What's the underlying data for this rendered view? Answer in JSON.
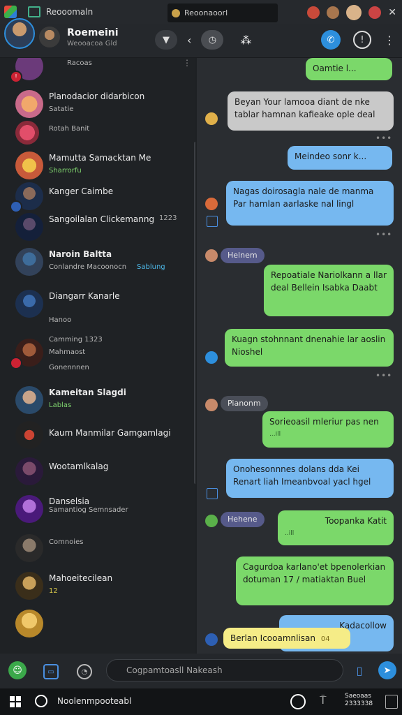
{
  "titlebar": {
    "tab1_label": "Reooomaln",
    "tab2_label": "Reoonaoorl",
    "close_glyph": "✕"
  },
  "header": {
    "title": "Roemeini",
    "subtitle": "Weooacoa Gld"
  },
  "sidebar": {
    "items": [
      {
        "name": "",
        "sub": "Racoas"
      },
      {
        "name": "Planodacior didarbicon",
        "sub": "Satatie"
      },
      {
        "name": "",
        "sub": "Rotah Banit"
      },
      {
        "name": "Mamutta Samacktan Me",
        "sub": "Sharrorfu"
      },
      {
        "name": "Kanger Caimbe",
        "sub": ""
      },
      {
        "name": "Sangoilalan Clickemanng",
        "sub": "",
        "extra": "1223"
      },
      {
        "name": "Naroin Baltta",
        "sub": "Conlandre Macoonocn",
        "extra": "Sablung"
      },
      {
        "name": "Diangarr Kanarle",
        "sub": "Hanoo"
      },
      {
        "name": "Camming 1323",
        "sub": "Mahmaost"
      },
      {
        "name": "",
        "sub": "Gonennnen"
      },
      {
        "name": "Kameitan Slagdi",
        "sub": "Lablas"
      },
      {
        "name": "Kaum Manmilar Gamgamlagi",
        "sub": ""
      },
      {
        "name": "Wootamlkalag",
        "sub": ""
      },
      {
        "name": "Danselsia",
        "sub": "Samantiog Semnsader"
      },
      {
        "name": "Comnoies",
        "sub": ""
      },
      {
        "name": "Mahoeitecilean",
        "sub": "12"
      }
    ]
  },
  "chat": {
    "messages": [
      {
        "text": "Oamtie l...",
        "kind": "green"
      },
      {
        "text": "Beyan Your lamooa diant de nke tablar hamnan kafieake ople deal",
        "kind": "gray"
      },
      {
        "text": "Meindeo sonr k...",
        "kind": "blue"
      },
      {
        "text": "Nagas doirosagla nale de manma Par hamlan aarlaske nal lingl",
        "kind": "blue"
      },
      {
        "text": "Repoatiale Nariolkann a llar deal Bellein Isabka Daabt",
        "kind": "green"
      },
      {
        "text": "Kuagn stohnnant dnenahie lar aoslin Nioshel",
        "kind": "green"
      },
      {
        "text": "Sorieoasil mleriur pas nen",
        "kind": "green",
        "meta": "...ill"
      },
      {
        "text": "Onohesonnnes dolans dda Kei Renart liah Imeanbvoal yacl hgel",
        "kind": "blue"
      },
      {
        "text": "Toopanka Katit",
        "kind": "green",
        "meta": "..ill"
      },
      {
        "text": "Cagurdoa karlano'et bpenolerkian dotuman 17 / matiaktan Buel",
        "kind": "green"
      },
      {
        "text": "Kadacollow",
        "kind": "blue"
      },
      {
        "text": "Berlan Icooamnlisan",
        "kind": "yellow",
        "meta": "04"
      }
    ],
    "senders": [
      "Helnem",
      "Pianonm",
      "Hehene"
    ]
  },
  "composer": {
    "placeholder": "Cogpamtoasll Nakeash"
  },
  "taskbar": {
    "search_label": "Noolenmpooteabl",
    "clock_line1": "Saeoaas",
    "clock_line2": "2333338"
  },
  "colors": {
    "accent_blue": "#2d8fdd",
    "bubble_green": "#7bd86a",
    "bubble_blue": "#76b8f0",
    "bubble_gray": "#c9c9c9",
    "bubble_yellow": "#f5ec87",
    "sender_pill": "#565a8a"
  },
  "icons": [
    "app-icon",
    "tab-icon",
    "minimize-icon",
    "avatar-icon",
    "close-icon",
    "filter-icon",
    "back-icon",
    "timer-icon",
    "share-icon",
    "call-icon",
    "info-icon",
    "more-icon",
    "new-chat-icon",
    "attach-icon",
    "emoji-icon",
    "mic-icon",
    "send-icon",
    "windows-start-icon",
    "search-icon"
  ]
}
